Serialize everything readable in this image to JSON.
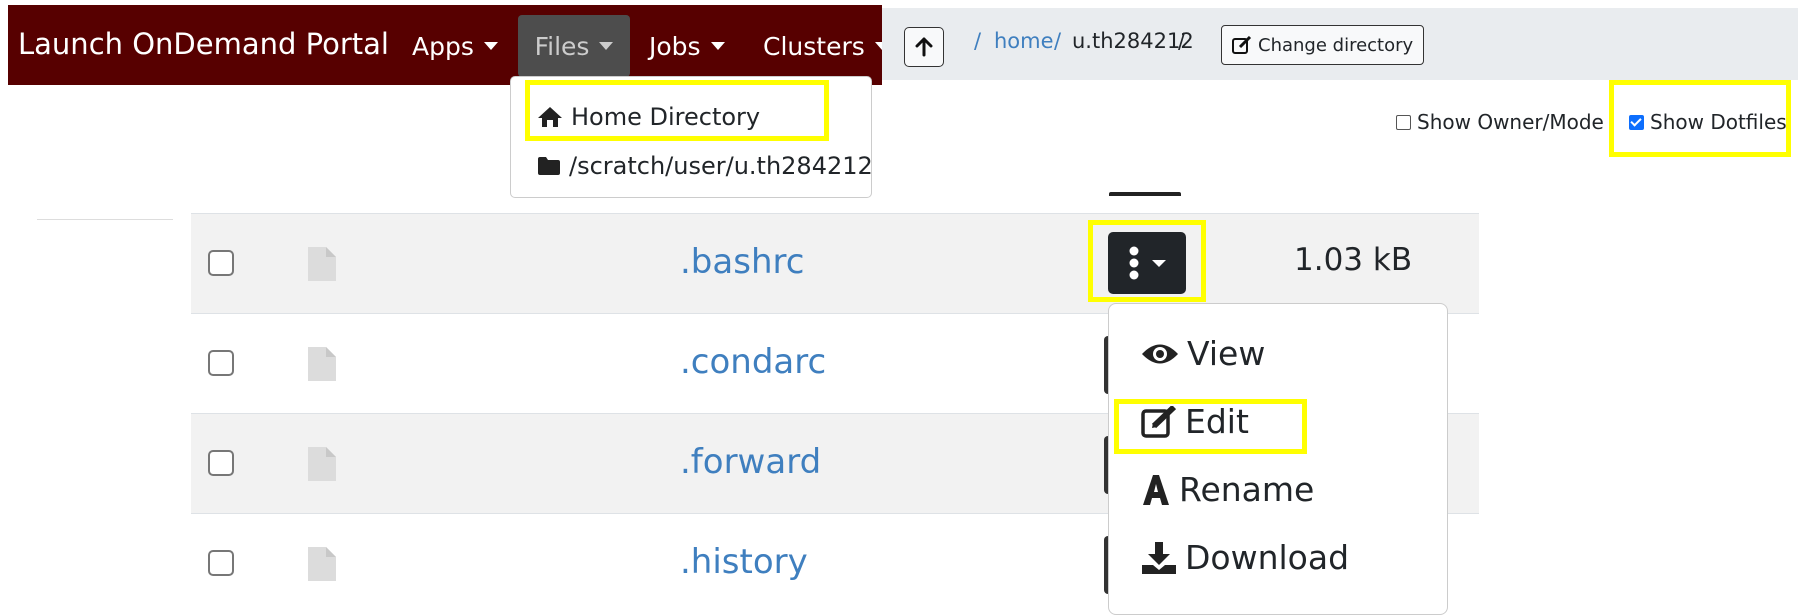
{
  "navbar": {
    "brand": "Launch OnDemand Portal",
    "items": [
      {
        "label": "Apps"
      },
      {
        "label": "Files"
      },
      {
        "label": "Jobs"
      },
      {
        "label": "Clusters"
      }
    ],
    "background": "#570000"
  },
  "files_menu": {
    "items": [
      {
        "label": "Home Directory",
        "icon": "home-icon"
      },
      {
        "label": "/scratch/user/u.th284212",
        "icon": "folder-icon"
      }
    ]
  },
  "breadcrumb": {
    "up_icon": "arrow-up-icon",
    "sep1": "/",
    "home_label": "home",
    "sep2": "/",
    "user_label": "u.th284212",
    "sep3": "/",
    "change_directory_label": "Change directory"
  },
  "options": {
    "show_owner_mode": {
      "label": "Show Owner/Mode",
      "checked": false
    },
    "show_dotfiles": {
      "label": "Show Dotfiles",
      "checked": true
    }
  },
  "files": [
    {
      "name": ".bashrc",
      "size": "1.03 kB"
    },
    {
      "name": ".condarc"
    },
    {
      "name": ".forward"
    },
    {
      "name": ".history"
    }
  ],
  "action_menu": {
    "items": [
      {
        "label": "View",
        "icon": "eye-icon"
      },
      {
        "label": "Edit",
        "icon": "edit-icon"
      },
      {
        "label": "Rename",
        "icon": "font-icon"
      },
      {
        "label": "Download",
        "icon": "download-icon"
      }
    ]
  },
  "colors": {
    "highlight": "#ffff00",
    "link": "#3f7fbf",
    "dark_button": "#212529"
  }
}
